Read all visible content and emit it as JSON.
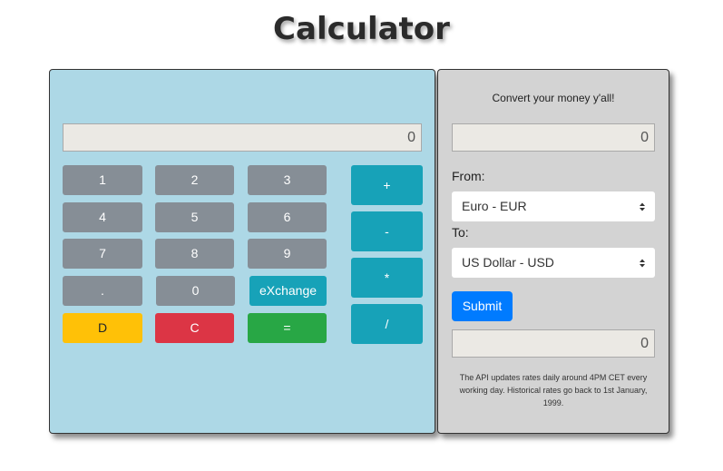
{
  "page": {
    "title": "Calculator"
  },
  "calculator": {
    "display_value": "0",
    "keys": {
      "one": "1",
      "two": "2",
      "three": "3",
      "four": "4",
      "five": "5",
      "six": "6",
      "seven": "7",
      "eight": "8",
      "nine": "9",
      "dot": ".",
      "zero": "0",
      "exchange": "eXchange",
      "delete": "D",
      "clear": "C",
      "equals": "="
    },
    "operators": {
      "plus": "+",
      "minus": "-",
      "multiply": "*",
      "divide": "/"
    }
  },
  "converter": {
    "heading": "Convert your money y'all!",
    "amount_value": "0",
    "from_label": "From:",
    "from_selected": "Euro - EUR",
    "to_label": "To:",
    "to_selected": "US Dollar - USD",
    "submit_label": "Submit",
    "result_value": "0",
    "note": "The API updates rates daily around 4PM CET every working day. Historical rates go back to 1st January, 1999."
  },
  "colors": {
    "calc_bg": "#add8e6",
    "converter_bg": "#d3d3d3",
    "number_key": "#868e96",
    "operator_key": "#17a2b8",
    "delete_key": "#ffc107",
    "clear_key": "#dc3545",
    "equals_key": "#28a745",
    "submit": "#007bff"
  },
  "icons": {
    "select_arrow": "chevron-updown-icon"
  }
}
